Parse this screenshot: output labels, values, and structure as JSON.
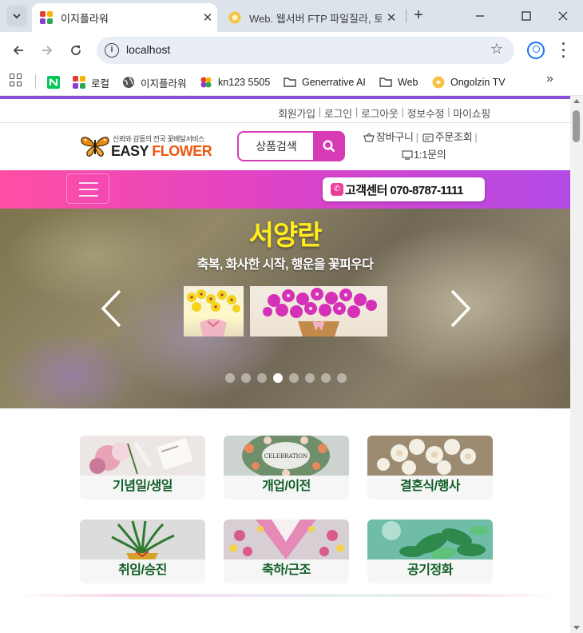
{
  "browser": {
    "tabs": [
      {
        "title": "이지플라워",
        "active": true,
        "close": "✕"
      },
      {
        "title": "Web. 웹서버 FTP 파일질라, 토",
        "active": false,
        "close": "✕"
      }
    ],
    "new_tab": "+",
    "url": "localhost",
    "bookmarks": [
      {
        "label": "",
        "icon": "naver-icon"
      },
      {
        "label": "로컬",
        "icon": "flower-favicon"
      },
      {
        "label": "이지플라워",
        "icon": "globe-icon"
      },
      {
        "label": "kn123 5505",
        "icon": "flower-favicon"
      },
      {
        "label": "Generrative AI",
        "icon": "folder-icon"
      },
      {
        "label": "Web",
        "icon": "folder-icon"
      },
      {
        "label": "Ongolzin TV",
        "icon": "ongolzin-icon"
      }
    ],
    "more": "»"
  },
  "site": {
    "member_links": [
      "회원가입",
      "로그인",
      "로그아웃",
      "정보수정",
      "마이쇼핑"
    ],
    "logo": {
      "tagline": "신뢰와 감동의 전국 꽃배달서비스",
      "easy": "EASY",
      "flower": "FLOWER"
    },
    "search_label": "상품검색",
    "util": {
      "cart": "장바구니",
      "order": "주문조회",
      "inquiry": "1:1문의"
    },
    "customer_center": "고객센터 070-8787-1111",
    "hero": {
      "title": "서양란",
      "subtitle": "축복, 화사한 시작, 행운을 꽃피우다",
      "dot_count": 8,
      "active_dot": 3
    },
    "categories": [
      {
        "label": "기념일/생일"
      },
      {
        "label": "개업/이전",
        "photo_text": "CELEBRATION"
      },
      {
        "label": "결혼식/행사"
      },
      {
        "label": "취임/승진"
      },
      {
        "label": "축하/근조"
      },
      {
        "label": "공기정화"
      }
    ]
  },
  "colors": {
    "accent": "#d63bb5",
    "topline": "#8a4fd6",
    "category_text": "#0e5d24",
    "hero_title": "#ffec1a"
  }
}
